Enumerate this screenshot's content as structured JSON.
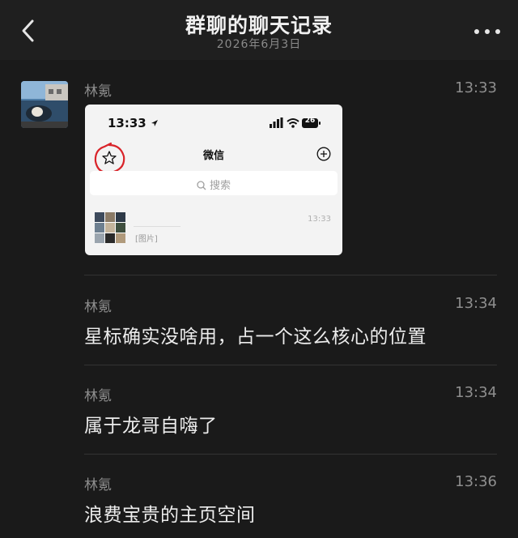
{
  "header": {
    "title": "群聊的聊天记录",
    "date": "2026年6月3日"
  },
  "messages": [
    {
      "sender": "林氪",
      "time": "13:33",
      "type": "image"
    },
    {
      "sender": "林氪",
      "time": "13:34",
      "text": "星标确实没啥用，占一个这么核心的位置"
    },
    {
      "sender": "林氪",
      "time": "13:34",
      "text": "属于龙哥自嗨了"
    },
    {
      "sender": "林氪",
      "time": "13:36",
      "text": "浪费宝贵的主页空间"
    }
  ],
  "screenshot": {
    "status_time": "13:33",
    "battery": "26",
    "title": "微信",
    "search_placeholder": "搜索",
    "chat_time": "13:33",
    "chat_preview": "[图片]",
    "annotation_color": "#d9242a"
  },
  "icons": {
    "back": "chevron-left-icon",
    "more": "more-dots-icon",
    "star": "star-icon",
    "plus": "add-circle-icon",
    "search": "search-icon"
  }
}
